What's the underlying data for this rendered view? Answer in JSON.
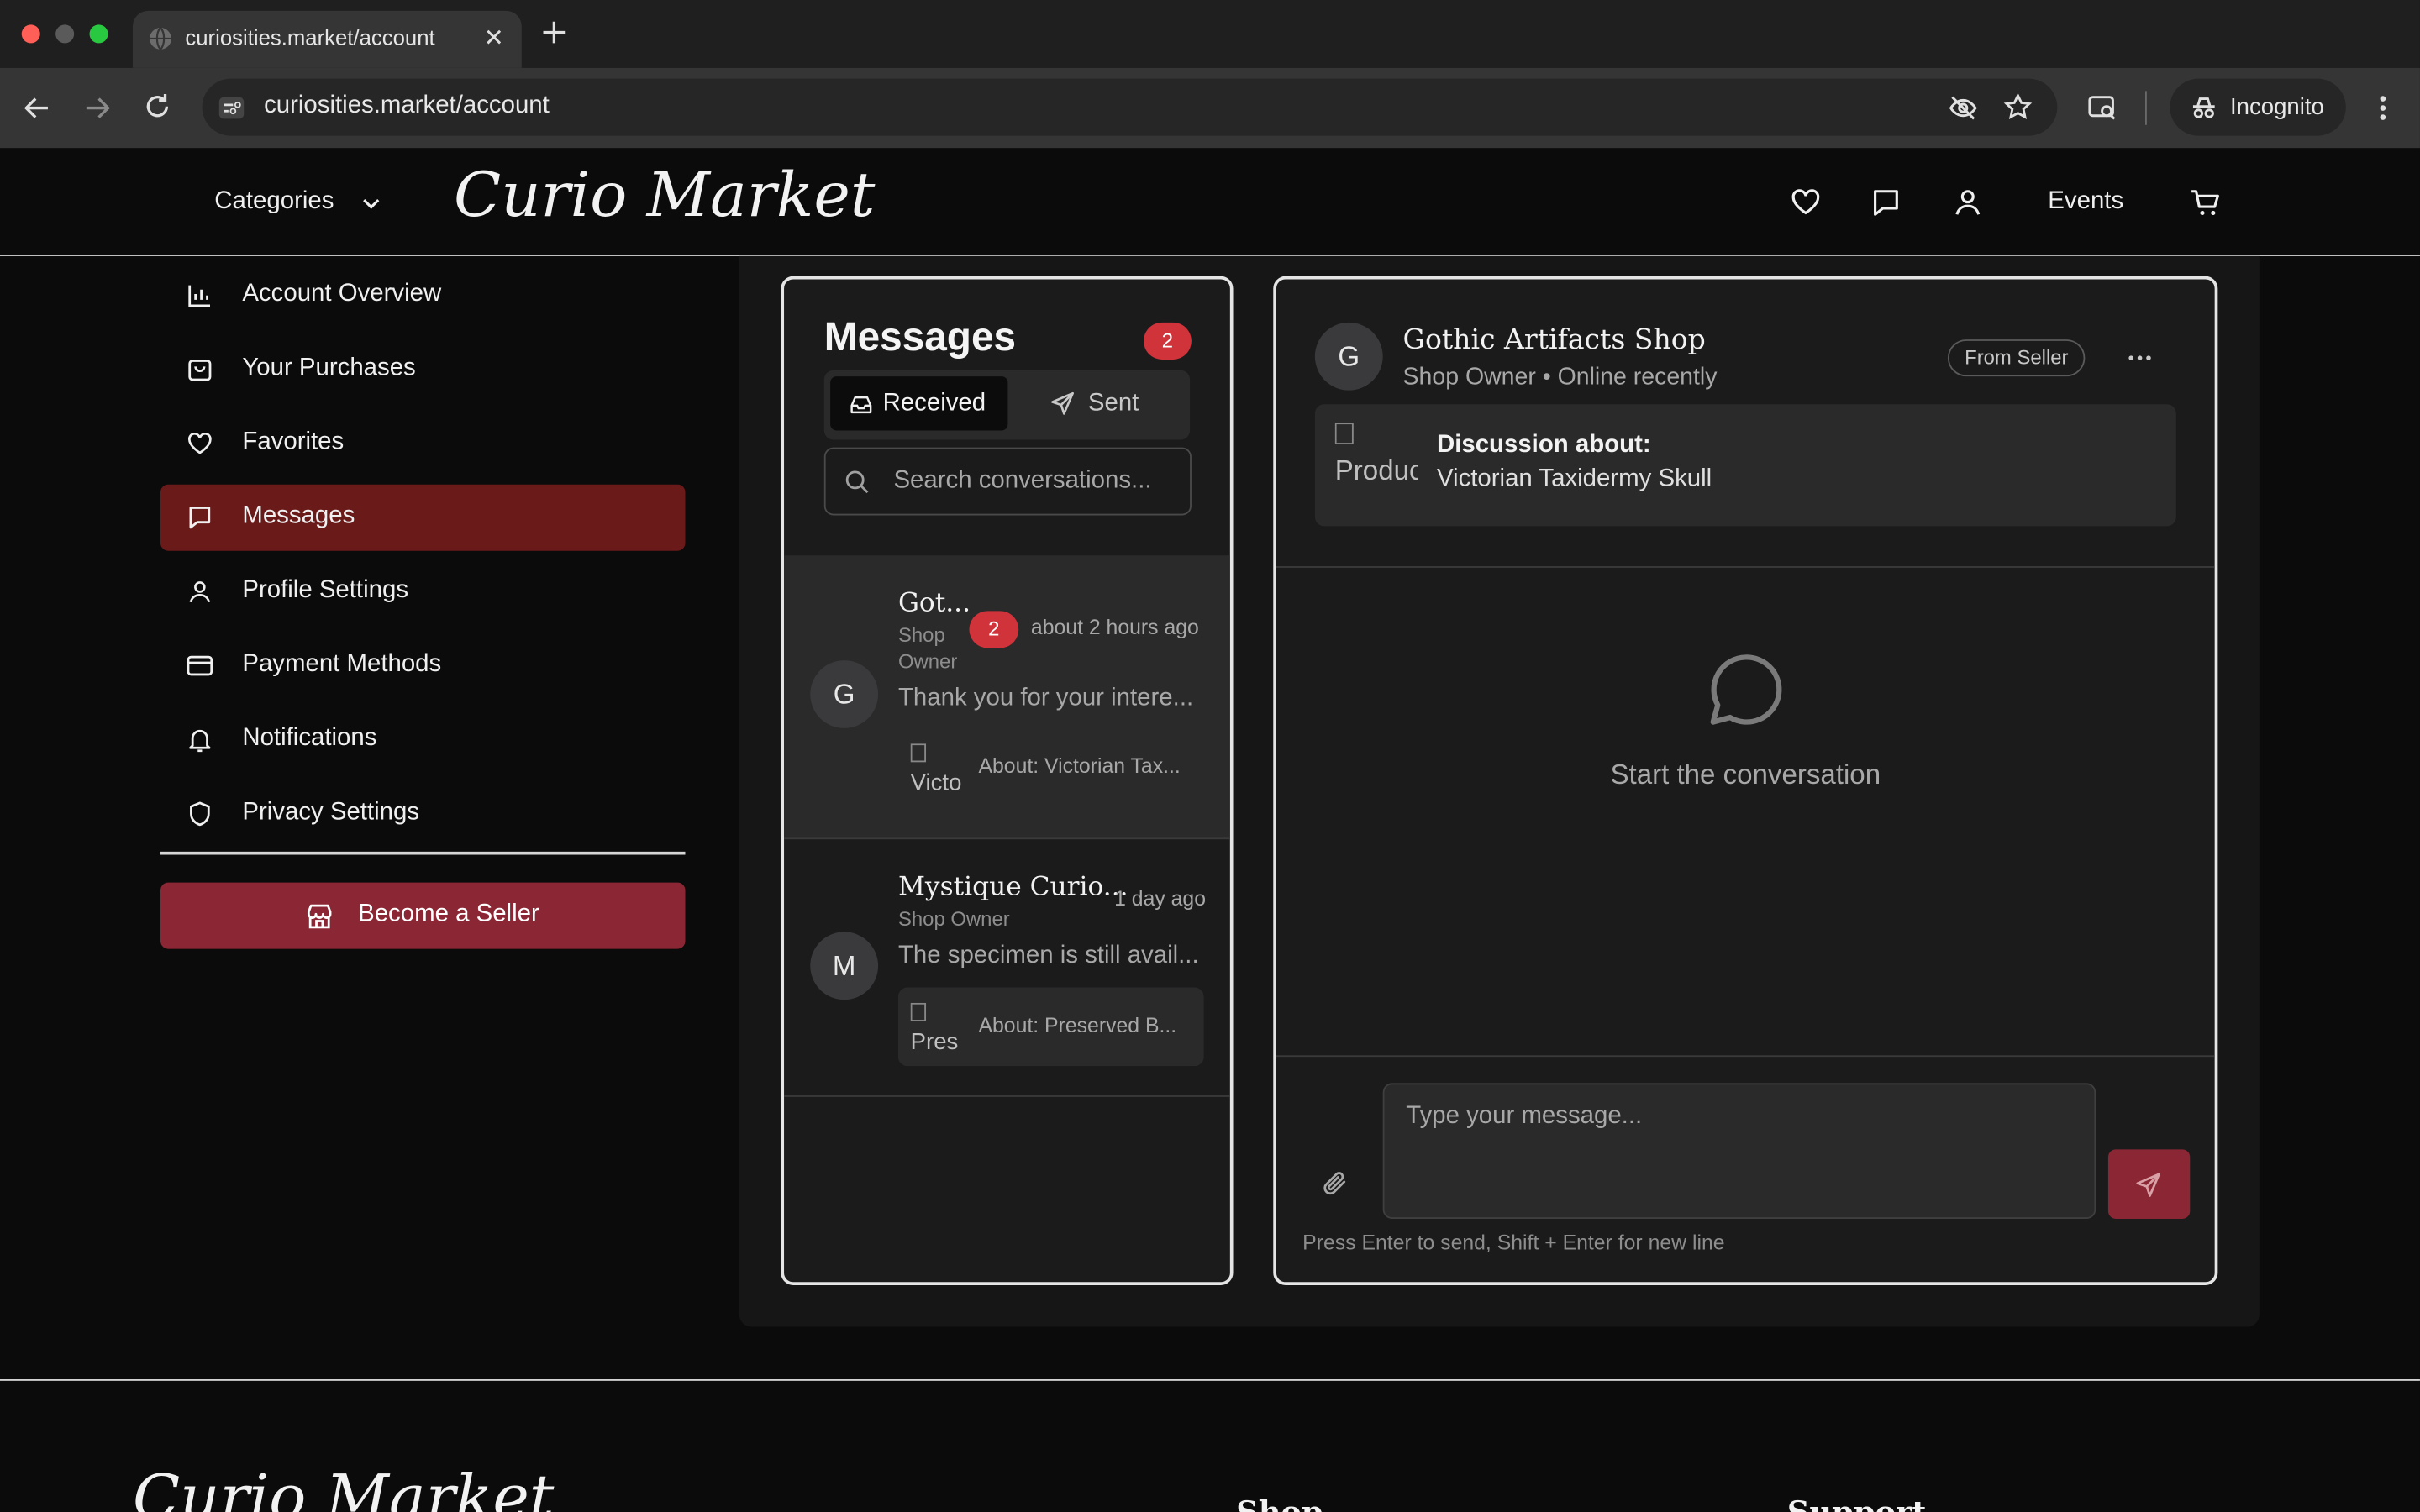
{
  "browser": {
    "tab_title": "curiosities.market/account",
    "url": "curiosities.market/account",
    "incognito_label": "Incognito"
  },
  "header": {
    "categories_label": "Categories",
    "logo_text": "Curio Market",
    "events_label": "Events"
  },
  "sidebar": {
    "items": [
      {
        "label": "Account Overview",
        "icon": "bar-chart-icon"
      },
      {
        "label": "Your Purchases",
        "icon": "shopping-bag-icon"
      },
      {
        "label": "Favorites",
        "icon": "heart-icon"
      },
      {
        "label": "Messages",
        "icon": "message-icon",
        "active": true
      },
      {
        "label": "Profile Settings",
        "icon": "user-icon"
      },
      {
        "label": "Payment Methods",
        "icon": "credit-card-icon"
      },
      {
        "label": "Notifications",
        "icon": "bell-icon"
      },
      {
        "label": "Privacy Settings",
        "icon": "shield-icon"
      }
    ],
    "become_seller_label": "Become a Seller"
  },
  "messages": {
    "title": "Messages",
    "unread_count": "2",
    "tabs": {
      "received": "Received",
      "sent": "Sent"
    },
    "search_placeholder": "Search conversations...",
    "conversations": [
      {
        "avatar": "G",
        "name": "Got...",
        "role_line1": "Shop",
        "role_line2": "Owner",
        "unread": "2",
        "time": "about 2 hours ago",
        "preview": "Thank you for your intere...",
        "product_alt": "Victo",
        "about": "About: Victorian Tax..."
      },
      {
        "avatar": "M",
        "name": "Mystique Curio...",
        "role": "Shop Owner",
        "time": "1 day ago",
        "preview": "The specimen is still avail...",
        "product_alt": "Pres",
        "about": "About: Preserved B..."
      }
    ]
  },
  "thread": {
    "avatar": "G",
    "shop_name": "Gothic Artifacts Shop",
    "status": "Shop Owner • Online recently",
    "badge": "From Seller",
    "product_alt": "Produc",
    "discussion_label": "Discussion about:",
    "discussion_item": "Victorian Taxidermy Skull",
    "empty_state": "Start the conversation",
    "message_placeholder": "Type your message...",
    "hint": "Press Enter to send, Shift + Enter for new line"
  },
  "footer": {
    "col_shop": "Shop",
    "col_support": "Support"
  },
  "colors": {
    "accent_active": "#6b1a1a",
    "seller_button": "#8b2734",
    "badge": "#d0333a"
  }
}
